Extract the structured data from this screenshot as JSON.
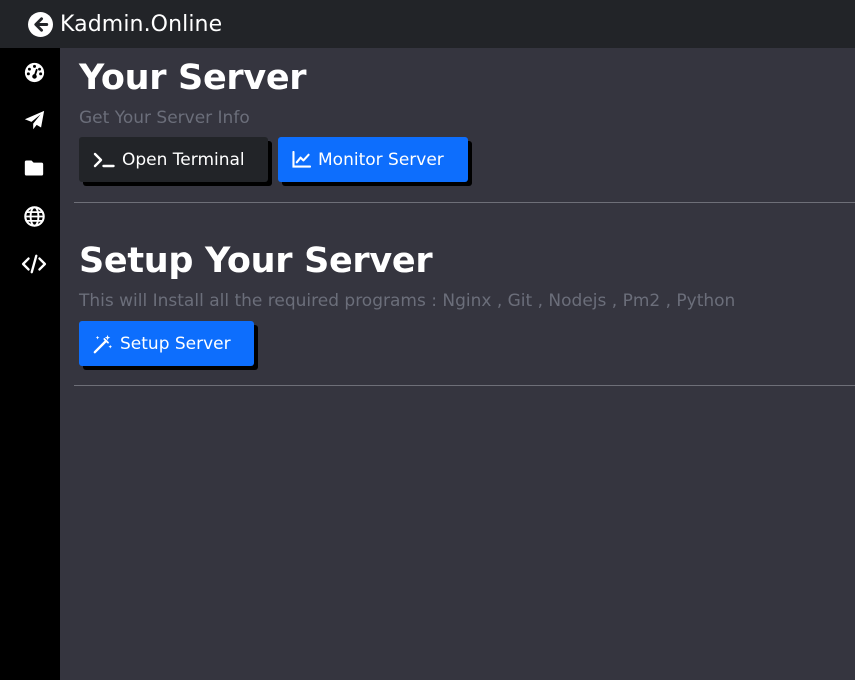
{
  "app": {
    "title": "Kadmin.Online"
  },
  "sidebar": {
    "items": [
      {
        "icon": "dashboard-icon"
      },
      {
        "icon": "paper-plane-icon"
      },
      {
        "icon": "folder-icon"
      },
      {
        "icon": "globe-icon"
      },
      {
        "icon": "code-icon"
      }
    ]
  },
  "server": {
    "title": "Your Server",
    "subtitle": "Get Your Server Info",
    "open_terminal_label": "Open Terminal",
    "monitor_label": "Monitor Server"
  },
  "setup": {
    "title": "Setup Your Server",
    "subtitle": "This will Install all the required programs : Nginx , Git , Nodejs , Pm2 , Python",
    "button_label": "Setup Server"
  },
  "colors": {
    "topbar": "#222428",
    "sidebar": "#000000",
    "main_bg": "#35353f",
    "primary_button": "#0d6efd",
    "dark_button": "#222428",
    "muted_text": "#6b6e7a"
  }
}
